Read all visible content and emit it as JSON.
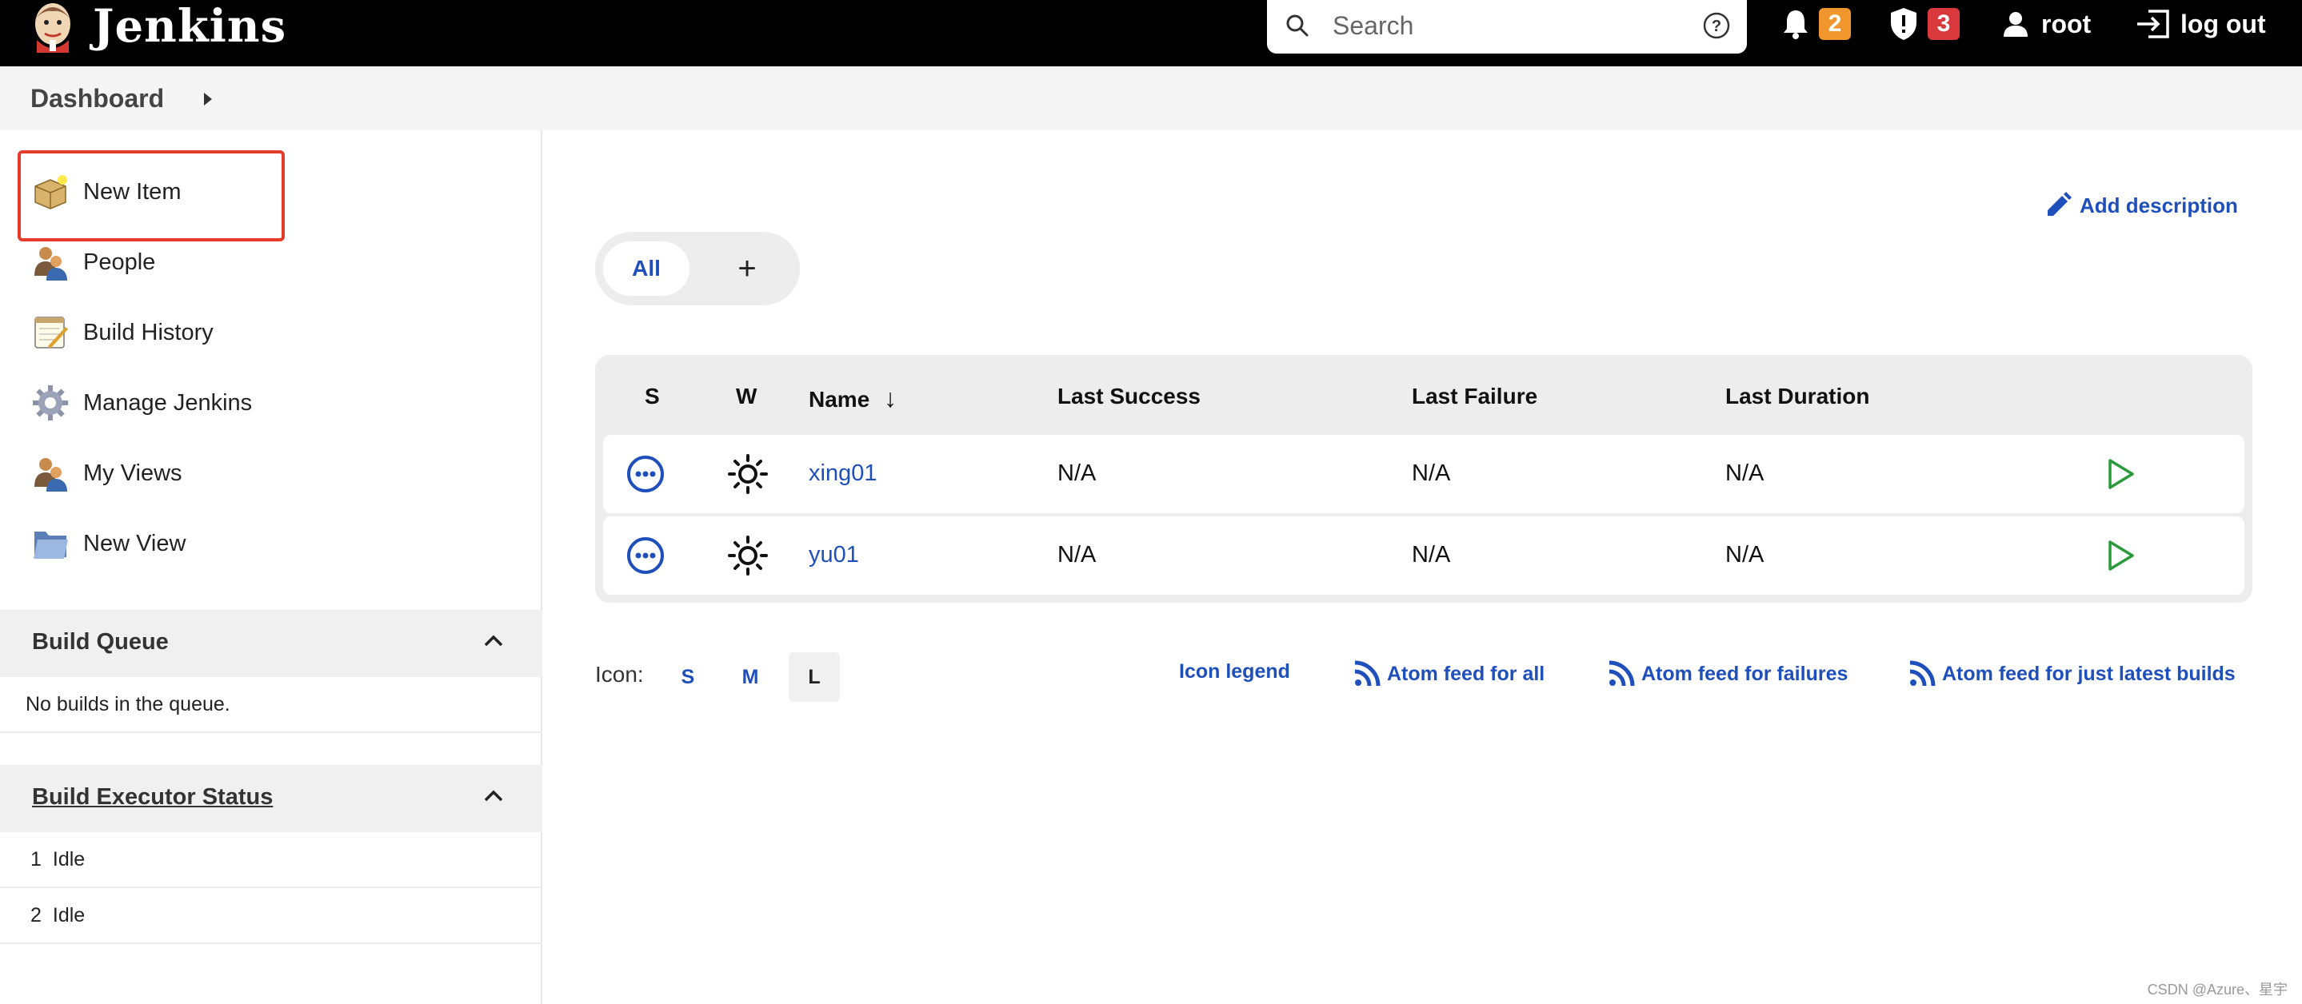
{
  "header": {
    "brand": "Jenkins",
    "search_placeholder": "Search",
    "notifications_count": "2",
    "security_count": "3",
    "user": "root",
    "logout": "log out",
    "colors": {
      "notif_badge": "#f0962c",
      "security_badge": "#d9383d"
    }
  },
  "breadcrumb": {
    "root": "Dashboard"
  },
  "sidebar": {
    "tasks": [
      {
        "label": "New Item",
        "icon": "new-item-box-icon"
      },
      {
        "label": "People",
        "icon": "people-icon"
      },
      {
        "label": "Build History",
        "icon": "notepad-icon"
      },
      {
        "label": "Manage Jenkins",
        "icon": "gear-icon"
      },
      {
        "label": "My Views",
        "icon": "people-icon"
      },
      {
        "label": "New View",
        "icon": "folder-icon"
      }
    ],
    "build_queue": {
      "title": "Build Queue",
      "empty": "No builds in the queue."
    },
    "executors": {
      "title": "Build Executor Status",
      "rows": [
        {
          "num": "1",
          "status": "Idle"
        },
        {
          "num": "2",
          "status": "Idle"
        }
      ]
    }
  },
  "main": {
    "add_description": "Add description",
    "tabs": {
      "all": "All",
      "add": "+"
    },
    "columns": {
      "s": "S",
      "w": "W",
      "name": "Name",
      "sort": "↓",
      "last_success": "Last Success",
      "last_failure": "Last Failure",
      "last_duration": "Last Duration"
    },
    "jobs": [
      {
        "name": "xing01",
        "last_success": "N/A",
        "last_failure": "N/A",
        "last_duration": "N/A"
      },
      {
        "name": "yu01",
        "last_success": "N/A",
        "last_failure": "N/A",
        "last_duration": "N/A"
      }
    ],
    "footer": {
      "icon_label": "Icon:",
      "sizes": [
        "S",
        "M",
        "L"
      ],
      "icon_legend": "Icon legend",
      "atom_all": "Atom feed for all",
      "atom_failures": "Atom feed for failures",
      "atom_latest": "Atom feed for just latest builds"
    }
  },
  "watermark": "CSDN @Azure、星宇"
}
